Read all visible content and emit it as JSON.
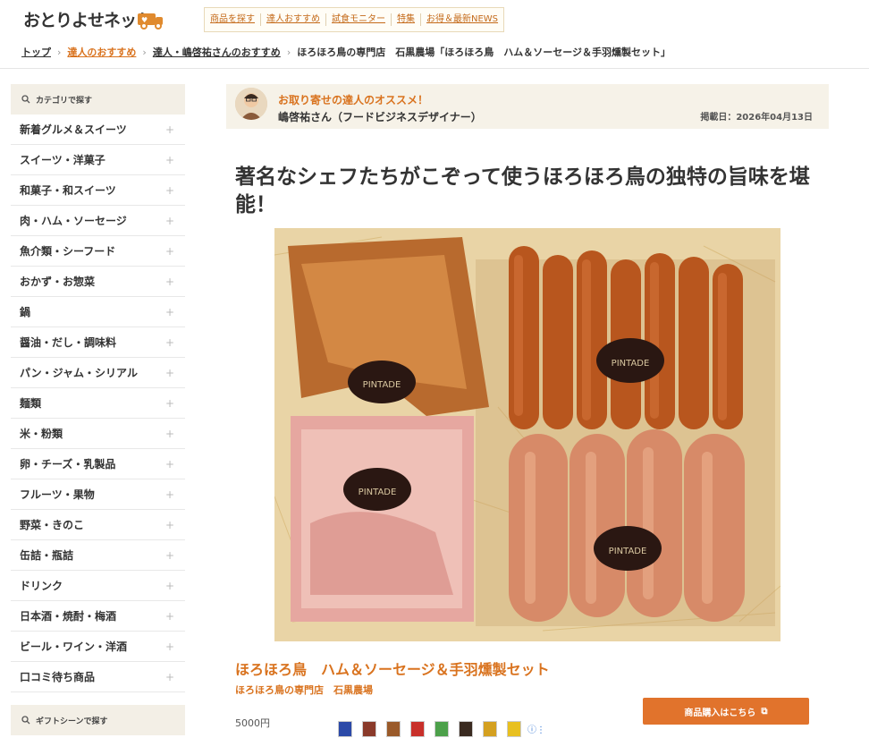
{
  "header": {
    "logo_text": "おとりよせネット",
    "nav": [
      "商品を探す",
      "達人おすすめ",
      "試食モニター",
      "特集",
      "お得＆最新NEWS"
    ]
  },
  "breadcrumb": {
    "items": [
      "トップ",
      "達人のおすすめ",
      "達人・嶋啓祐さんのおすすめ",
      "ほろほろ鳥の専門店　石黒農場「ほろほろ鳥　ハム＆ソーセージ＆手羽燻製セット」"
    ]
  },
  "sidebar": {
    "search_label": "カテゴリで探す",
    "categories": [
      "新着グルメ＆スイーツ",
      "スイーツ・洋菓子",
      "和菓子・和スイーツ",
      "肉・ハム・ソーセージ",
      "魚介類・シーフード",
      "おかず・お惣菜",
      "鍋",
      "醤油・だし・調味料",
      "パン・ジャム・シリアル",
      "麺類",
      "米・粉類",
      "卵・チーズ・乳製品",
      "フルーツ・果物",
      "野菜・きのこ",
      "缶詰・瓶詰",
      "ドリンク",
      "日本酒・焼酎・梅酒",
      "ビール・ワイン・洋酒",
      "口コミ待ち商品"
    ],
    "gift_label": "ギフトシーンで探す",
    "plus": "+"
  },
  "expert": {
    "tag": "お取り寄せの達人のオススメ！",
    "name": "嶋啓祐さん（フードビジネスデザイナー）",
    "date": "掲載日：2026年04月13日"
  },
  "article": {
    "headline": "著名なシェフたちがこぞって使うほろほろ鳥の独特の旨味を堪能！"
  },
  "photo": {
    "label_text": "PINTADE"
  },
  "product": {
    "title": "ほろほろ鳥　ハム＆ソーセージ＆手羽燻製セット",
    "shop": "ほろほろ鳥の専門店　石黒農場",
    "price": "5000円",
    "buy_label": "商品購入はこちら"
  },
  "colors": {
    "accent": "#d9731f",
    "button": "#e1732c",
    "panel": "#f6f2e8"
  }
}
